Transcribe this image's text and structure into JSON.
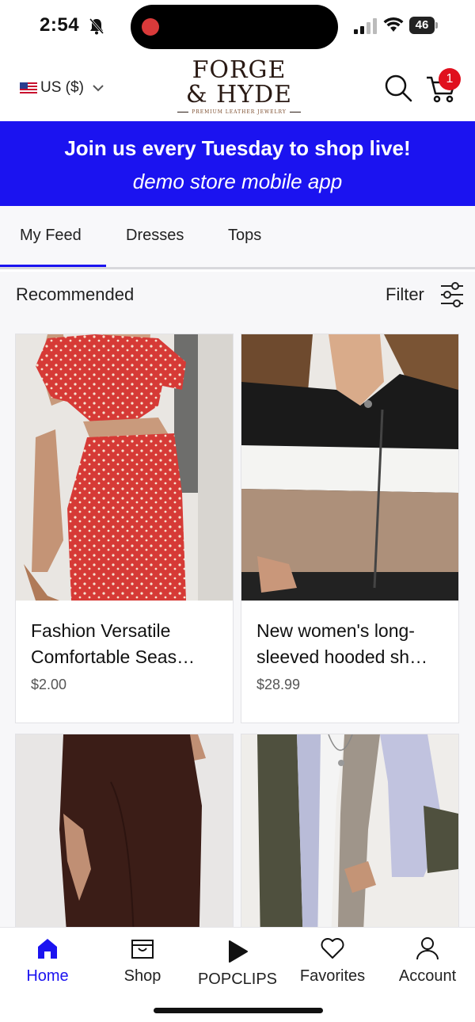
{
  "status_bar": {
    "time": "2:54",
    "battery": "46"
  },
  "header": {
    "currency": "US ($)",
    "logo_line1": "FORGE",
    "logo_line2": "& HYDE",
    "logo_tagline": "PREMIUM LEATHER JEWELRY",
    "cart_count": "1",
    "icons": [
      "bell-slash-icon",
      "signal-icon",
      "wifi-icon",
      "flag-icon",
      "chevron-down-icon",
      "search-icon",
      "cart-icon"
    ]
  },
  "banner": {
    "title": "Join us every Tuesday to shop live!",
    "subtitle": "demo store mobile app",
    "color": "#1b13f0"
  },
  "tabs": [
    {
      "label": "My Feed",
      "active": true
    },
    {
      "label": "Dresses",
      "active": false
    },
    {
      "label": "Tops",
      "active": false
    }
  ],
  "section": {
    "title": "Recommended",
    "filter_label": "Filter"
  },
  "products": [
    {
      "title": "Fashion Versatile Comfortable Seas…",
      "price": "$2.00"
    },
    {
      "title": "New women's long-sleeved hooded sh…",
      "price": "$28.99"
    },
    {
      "title": "",
      "price": ""
    },
    {
      "title": "",
      "price": ""
    }
  ],
  "bottom_nav": [
    {
      "label": "Home",
      "icon": "home-icon",
      "active": true
    },
    {
      "label": "Shop",
      "icon": "shopping-bag-icon",
      "active": false
    },
    {
      "label": "POPCLIPS",
      "icon": "play-icon",
      "active": false
    },
    {
      "label": "Favorites",
      "icon": "heart-icon",
      "active": false
    },
    {
      "label": "Account",
      "icon": "user-icon",
      "active": false
    }
  ],
  "colors": {
    "accent": "#1b13f0",
    "badge": "#e0101e"
  }
}
